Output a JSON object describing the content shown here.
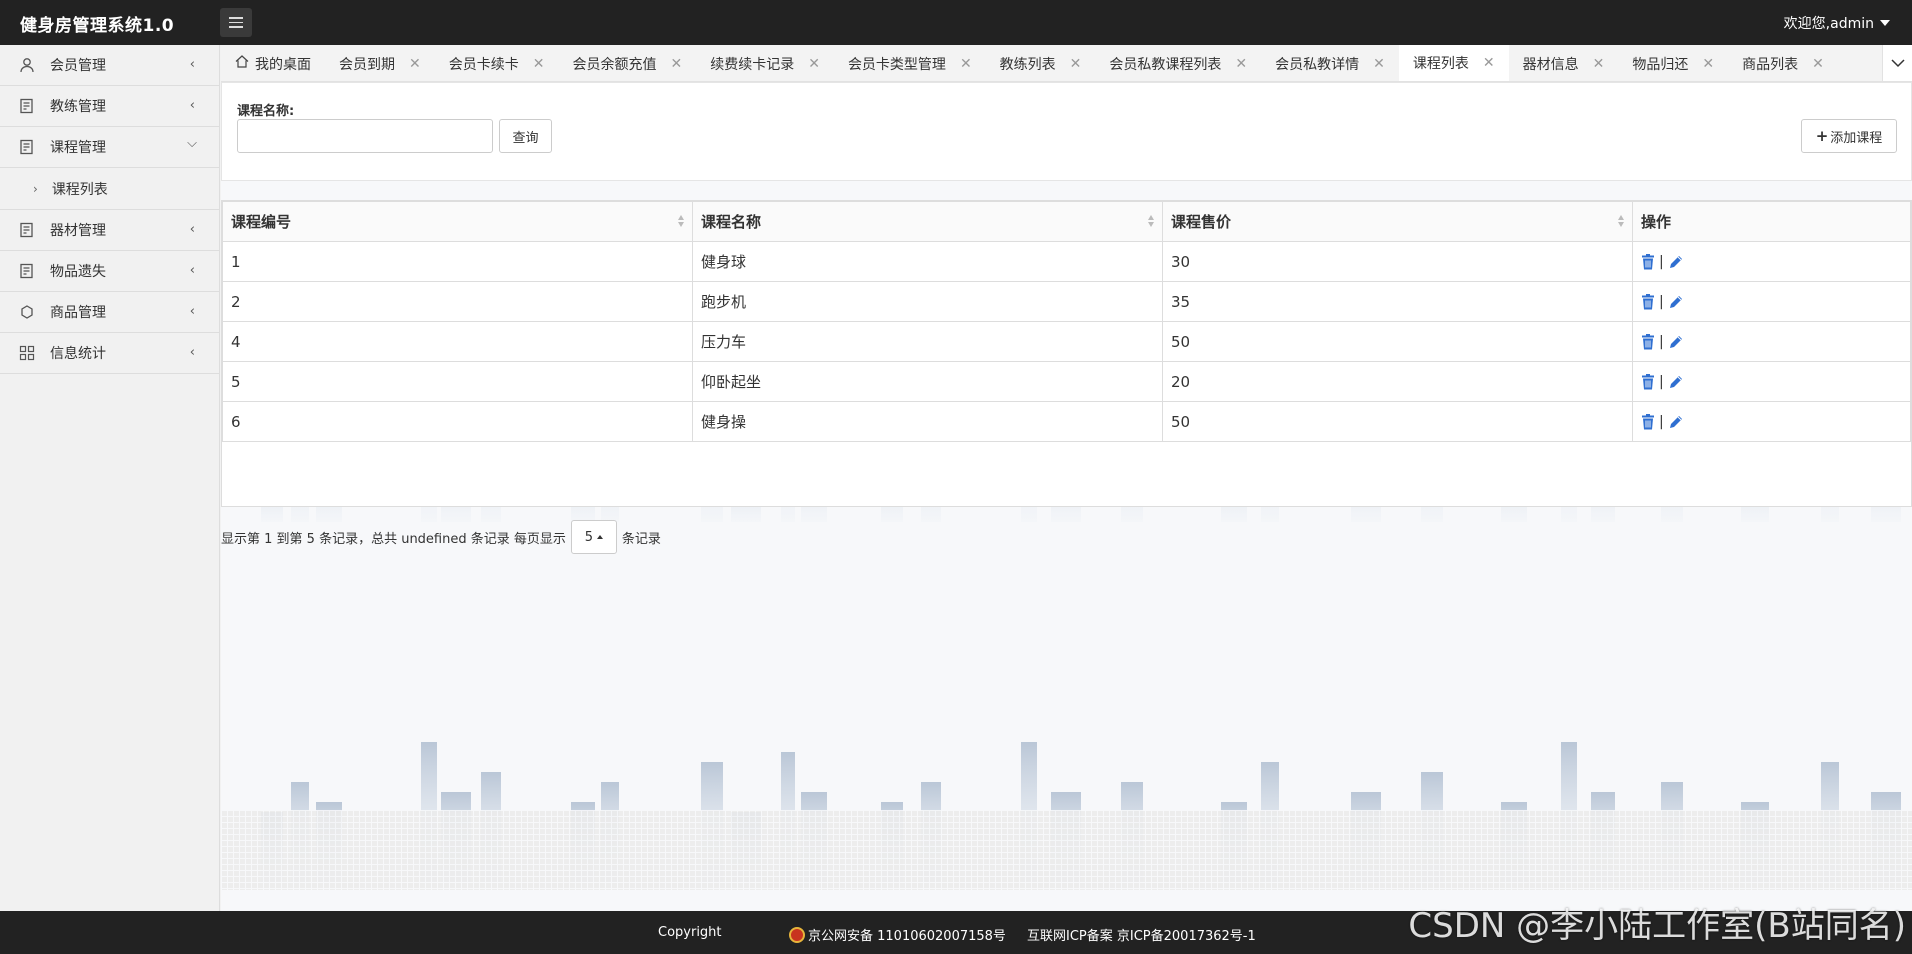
{
  "app": {
    "title": "健身房管理系统1.0",
    "welcome": "欢迎您,admin"
  },
  "sidebar": {
    "items": [
      {
        "label": "会员管理",
        "icon": "user-icon"
      },
      {
        "label": "教练管理",
        "icon": "document-icon"
      },
      {
        "label": "课程管理",
        "icon": "document-icon",
        "expanded": true
      },
      {
        "label": "器材管理",
        "icon": "document-icon"
      },
      {
        "label": "物品遗失",
        "icon": "document-icon"
      },
      {
        "label": "商品管理",
        "icon": "cycle-icon"
      },
      {
        "label": "信息统计",
        "icon": "grid-icon"
      }
    ],
    "sub_items": [
      {
        "label": "课程列表"
      }
    ]
  },
  "tabs": [
    {
      "label": "我的桌面",
      "home": true
    },
    {
      "label": "会员到期"
    },
    {
      "label": "会员卡续卡"
    },
    {
      "label": "会员余额充值"
    },
    {
      "label": "续费续卡记录"
    },
    {
      "label": "会员卡类型管理"
    },
    {
      "label": "教练列表"
    },
    {
      "label": "会员私教课程列表"
    },
    {
      "label": "会员私教详情"
    },
    {
      "label": "课程列表",
      "active": true
    },
    {
      "label": "器材信息"
    },
    {
      "label": "物品归还"
    },
    {
      "label": "商品列表"
    }
  ],
  "search": {
    "label": "课程名称:",
    "value": "",
    "query_button": "查询",
    "add_button": "添加课程"
  },
  "table": {
    "columns": [
      "课程编号",
      "课程名称",
      "课程售价",
      "操作"
    ],
    "rows": [
      {
        "id": "1",
        "name": "健身球",
        "price": "30"
      },
      {
        "id": "2",
        "name": "跑步机",
        "price": "35"
      },
      {
        "id": "4",
        "name": "压力车",
        "price": "50"
      },
      {
        "id": "5",
        "name": "仰卧起坐",
        "price": "20"
      },
      {
        "id": "6",
        "name": "健身操",
        "price": "50"
      }
    ],
    "op_separator": "|"
  },
  "pager": {
    "prefix": "显示第 1 到第 5 条记录，总共 undefined 条记录 每页显示",
    "page_size": "5",
    "suffix": "条记录"
  },
  "footer": {
    "copyright": "Copyright",
    "police": "京公网安备 11010602007158号",
    "icp": "互联网ICP备案 京ICP备20017362号-1"
  },
  "watermark": "CSDN @李小陆工作室(B站同名)",
  "colors": {
    "header_bg": "#222222",
    "icon_blue": "#2f6fd1",
    "footer_bg": "#222222"
  }
}
